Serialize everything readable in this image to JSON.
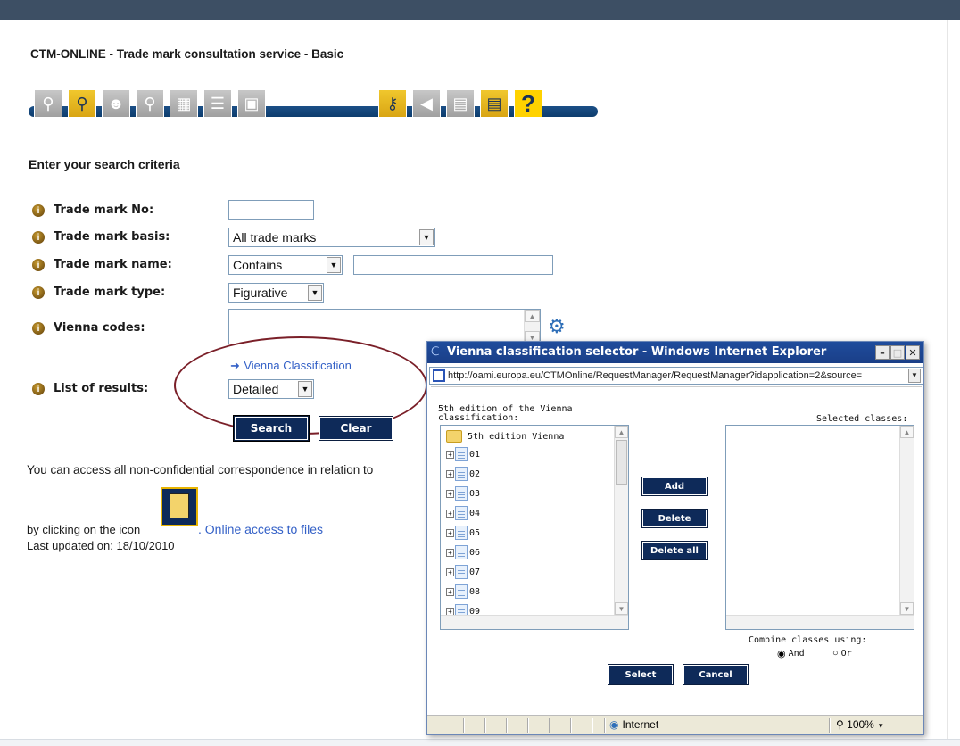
{
  "page": {
    "title": "CTM-ONLINE - Trade mark consultation service - Basic",
    "section_heading": "Enter your search criteria"
  },
  "toolbar": {
    "icons": [
      "search-simple-icon",
      "search-advanced-icon",
      "search-people-icon",
      "search-image-icon",
      "document-edit-icon",
      "list-icon",
      "document-view-icon",
      "key-icon",
      "back-icon",
      "save-icon",
      "print-icon",
      "help-icon"
    ],
    "help_glyph": "?"
  },
  "form": {
    "trade_mark_no": {
      "label": "Trade mark No:",
      "value": ""
    },
    "trade_mark_basis": {
      "label": "Trade mark basis:",
      "selected": "All trade marks"
    },
    "trade_mark_name": {
      "label": "Trade mark name:",
      "operator": "Contains",
      "value": ""
    },
    "trade_mark_type": {
      "label": "Trade mark type:",
      "selected": "Figurative"
    },
    "vienna_codes": {
      "label": "Vienna codes:",
      "value": ""
    },
    "vienna_link": "Vienna Classification",
    "list_of_results": {
      "label": "List of results:",
      "selected": "Detailed"
    },
    "search_label": "Search",
    "clear_label": "Clear"
  },
  "info": {
    "correspondence": "You can access all non-confidential correspondence in relation to",
    "clicking_prefix": "by clicking on the icon",
    "online_access_link": ". Online access to files",
    "last_updated": "Last updated on: 18/10/2010"
  },
  "popup": {
    "title": "Vienna classification selector - Windows Internet Explorer",
    "url": "http://oami.europa.eu/CTMOnline/RequestManager/RequestManager?idapplication=2&source=",
    "left_header": "5th edition of the Vienna classification:",
    "right_header": "Selected classes:",
    "root_node": "5th edition  Vienna",
    "nodes": [
      "01",
      "02",
      "03",
      "04",
      "05",
      "06",
      "07",
      "08",
      "09"
    ],
    "add_label": "Add",
    "delete_label": "Delete",
    "delete_all_label": "Delete all",
    "combine_label": "Combine classes using:",
    "and_label": "And",
    "or_label": "Or",
    "select_label": "Select",
    "cancel_label": "Cancel",
    "status_zone": "Internet",
    "zoom": "100%"
  },
  "colors": {
    "navy_button": "#0e2a59",
    "link": "#3461c7",
    "oval": "#7a1f28",
    "toolbar_line": "#1b4f86"
  }
}
